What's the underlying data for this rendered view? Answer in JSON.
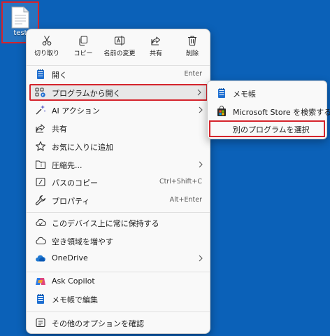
{
  "desktop": {
    "file_label": "test"
  },
  "toolbar": {
    "cut": "切り取り",
    "copy": "コピー",
    "rename": "名前の変更",
    "share": "共有",
    "delete": "削除"
  },
  "menu": {
    "open": {
      "label": "開く",
      "shortcut": "Enter"
    },
    "open_with": {
      "label": "プログラムから開く"
    },
    "ai_action": {
      "label": "AI アクション"
    },
    "share": {
      "label": "共有"
    },
    "favorite": {
      "label": "お気に入りに追加"
    },
    "compress": {
      "label": "圧縮先..."
    },
    "copy_path": {
      "label": "パスのコピー",
      "shortcut": "Ctrl+Shift+C"
    },
    "properties": {
      "label": "プロパティ",
      "shortcut": "Alt+Enter"
    },
    "keep_on_device": {
      "label": "このデバイス上に常に保持する"
    },
    "free_space": {
      "label": "空き領域を増やす"
    },
    "onedrive": {
      "label": "OneDrive"
    },
    "ask_copilot": {
      "label": "Ask Copilot"
    },
    "edit_notepad": {
      "label": "メモ帳で編集"
    },
    "more_options": {
      "label": "その他のオプションを確認"
    }
  },
  "submenu": {
    "notepad": "メモ帳",
    "store_search": "Microsoft Store を検索する",
    "choose_program": "別のプログラムを選択"
  },
  "colors": {
    "desktop_bg": "#0b61b8",
    "highlight_border": "#d5242c",
    "menu_bg": "#f9f9f9"
  }
}
